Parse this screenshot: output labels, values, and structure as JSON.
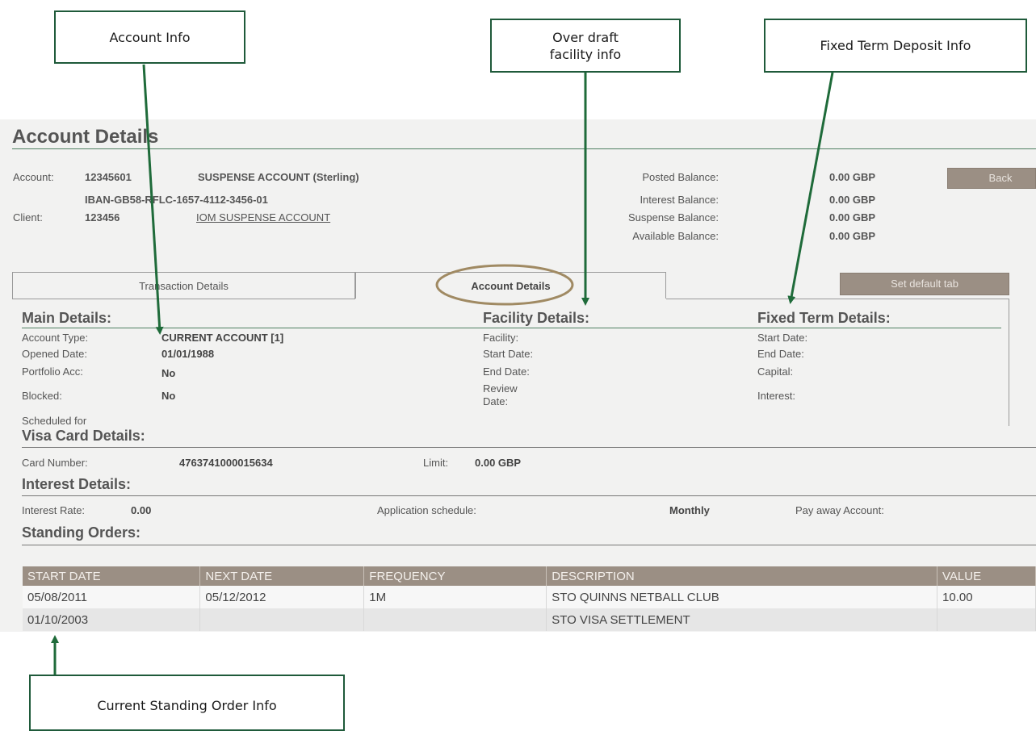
{
  "callouts": {
    "account_info": "Account Info",
    "overdraft_info_line1": "Over draft",
    "overdraft_info_line2": "facility info",
    "fixed_term_info": "Fixed Term Deposit Info",
    "standing_order_info": "Current Standing Order Info"
  },
  "page_title": "Account Details",
  "account": {
    "account_label": "Account:",
    "account_number": "12345601",
    "account_name": "SUSPENSE ACCOUNT (Sterling)",
    "iban": "IBAN-GB58-RFLC-1657-4112-3456-01",
    "client_label": "Client:",
    "client_number": "123456",
    "client_name": "IOM SUSPENSE ACCOUNT"
  },
  "balances": {
    "posted_label": "Posted Balance:",
    "posted_value": "0.00 GBP",
    "interest_label": "Interest Balance:",
    "interest_value": "0.00 GBP",
    "suspense_label": "Suspense Balance:",
    "suspense_value": "0.00 GBP",
    "available_label": "Available Balance:",
    "available_value": "0.00 GBP"
  },
  "buttons": {
    "back": "Back",
    "set_default_tab": "Set default tab"
  },
  "tabs": [
    {
      "label": "Transaction Details",
      "active": false
    },
    {
      "label": "Account Details",
      "active": true
    }
  ],
  "main_details": {
    "heading": "Main Details:",
    "account_type_label": "Account Type:",
    "account_type_value": "CURRENT ACCOUNT [1]",
    "opened_date_label": "Opened Date:",
    "opened_date_value": "01/01/1988",
    "portfolio_label": "Portfolio Acc:",
    "portfolio_value": "No",
    "blocked_label": "Blocked:",
    "blocked_value": "No",
    "scheduled_label": "Scheduled for"
  },
  "facility_details": {
    "heading": "Facility Details:",
    "facility_label": "Facility:",
    "start_date_label": "Start Date:",
    "end_date_label": "End Date:",
    "review_date_label_1": "Review",
    "review_date_label_2": "Date:"
  },
  "fixed_term_details": {
    "heading": "Fixed Term Details:",
    "start_date_label": "Start Date:",
    "end_date_label": "End Date:",
    "capital_label": "Capital:",
    "interest_label": "Interest:"
  },
  "visa_card": {
    "heading": "Visa Card Details:",
    "card_number_label": "Card Number:",
    "card_number_value": "4763741000015634",
    "limit_label": "Limit:",
    "limit_value": "0.00 GBP"
  },
  "interest_details": {
    "heading": "Interest Details:",
    "rate_label": "Interest Rate:",
    "rate_value": "0.00",
    "schedule_label": "Application schedule:",
    "schedule_value": "Monthly",
    "pay_away_label": "Pay away Account:"
  },
  "standing_orders": {
    "heading": "Standing Orders:",
    "columns": [
      "START DATE",
      "NEXT DATE",
      "FREQUENCY",
      "DESCRIPTION",
      "VALUE"
    ],
    "rows": [
      [
        "05/08/2011",
        "05/12/2012",
        "1M",
        "STO QUINNS NETBALL CLUB",
        "10.00"
      ],
      [
        "01/10/2003",
        "",
        "",
        "STO VISA SETTLEMENT",
        ""
      ]
    ]
  },
  "colors": {
    "callout_border": "#1f5a3a",
    "arrow": "#1f6b3a",
    "header_bar": "#9b8f84",
    "highlight_ellipse": "#a08a63"
  },
  "icons": {
    "arrow": "arrow-pointer-icon"
  }
}
